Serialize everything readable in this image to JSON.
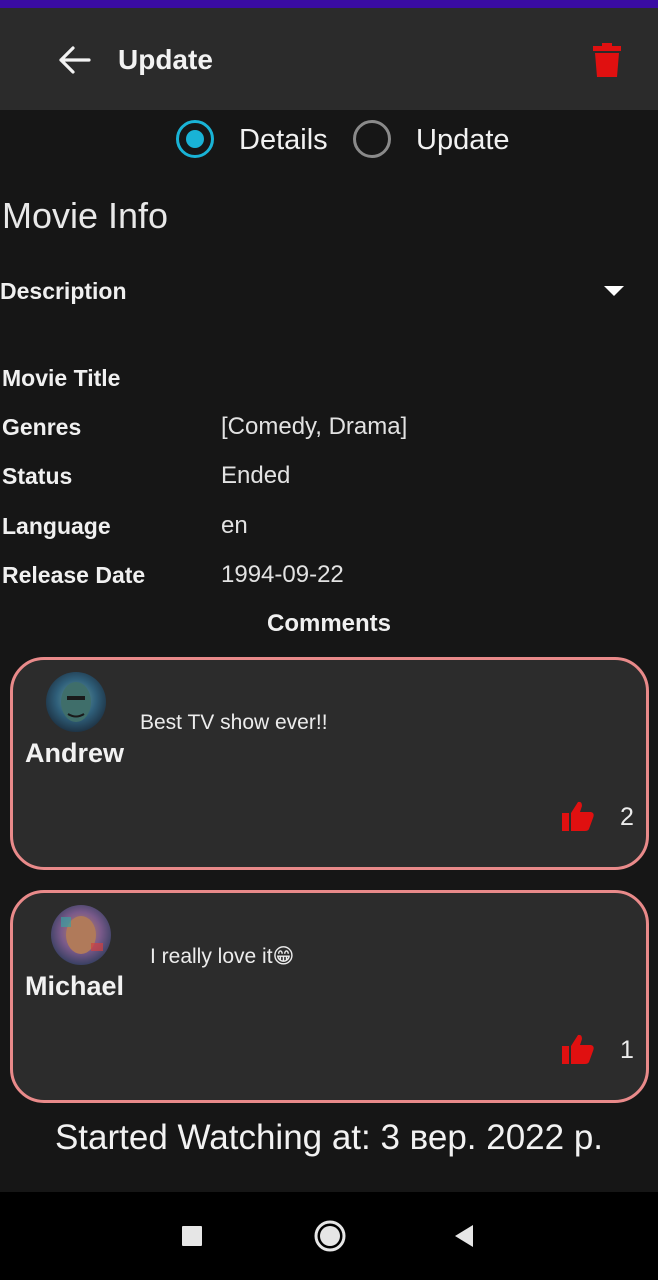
{
  "appbar": {
    "title": "Update"
  },
  "mode_selector": {
    "options": [
      {
        "label": "Details",
        "selected": true
      },
      {
        "label": "Update",
        "selected": false
      }
    ]
  },
  "section_title": "Movie Info",
  "description": {
    "label": "Description"
  },
  "info": {
    "title_label": "Movie Title",
    "title_value": "",
    "genres_label": "Genres",
    "genres_value": "[Comedy, Drama]",
    "status_label": "Status",
    "status_value": "Ended",
    "language_label": "Language",
    "language_value": "en",
    "release_label": "Release Date",
    "release_value": "1994-09-22"
  },
  "comments": {
    "title": "Comments",
    "items": [
      {
        "author": "Andrew",
        "text": "Best TV show ever!!",
        "likes": "2"
      },
      {
        "author": "Michael",
        "text": "I really love it😁",
        "likes": "1"
      }
    ]
  },
  "started_watching": "Started Watching at: 3 вер. 2022 р.",
  "colors": {
    "accent": "#19b3d6",
    "delete": "#e01010",
    "like": "#e01010",
    "card_border": "#e98a8a",
    "status_bar": "#3a0ca3"
  },
  "icons": {
    "back": "arrow-left-icon",
    "delete": "trash-icon",
    "expand": "caret-down-icon",
    "like": "thumbs-up-icon",
    "nav_recents": "square-icon",
    "nav_home": "circle-icon",
    "nav_back": "triangle-left-icon"
  }
}
